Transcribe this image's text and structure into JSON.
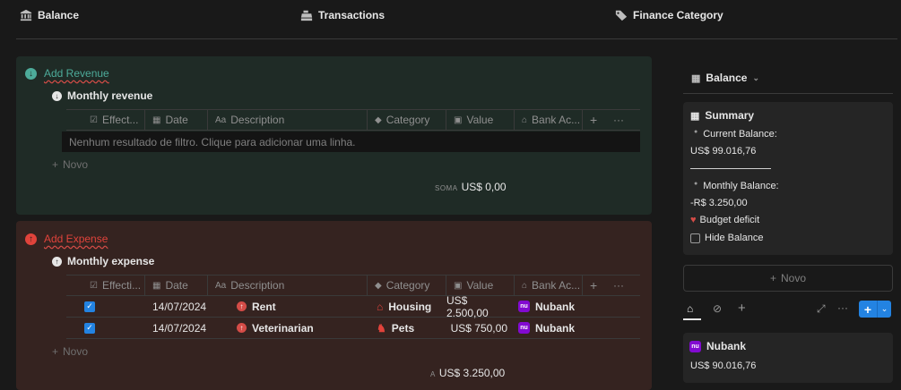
{
  "nav": {
    "balance": "Balance",
    "transactions": "Transactions",
    "finance_category": "Finance Category"
  },
  "revenue": {
    "title": "Add Revenue",
    "subtitle": "Monthly revenue",
    "columns": [
      "Effect...",
      "Date",
      "Description",
      "Category",
      "Value",
      "Bank Ac..."
    ],
    "empty_text": "Nenhum resultado de filtro. Clique para adicionar uma linha.",
    "new_label": "Novo",
    "sum_label": "SOMA",
    "sum_value": "US$ 0,00"
  },
  "expense": {
    "title": "Add Expense",
    "subtitle": "Monthly expense",
    "columns": [
      "Effecti...",
      "Date",
      "Description",
      "Category",
      "Value",
      "Bank Ac..."
    ],
    "rows": [
      {
        "checked": true,
        "date": "14/07/2024",
        "description": "Rent",
        "category": "Housing",
        "value": "US$ 2.500,00",
        "bank": "Nubank"
      },
      {
        "checked": true,
        "date": "14/07/2024",
        "description": "Veterinarian",
        "category": "Pets",
        "value": "US$ 750,00",
        "bank": "Nubank"
      }
    ],
    "new_label": "Novo",
    "sum_label": "A",
    "sum_value": "US$ 3.250,00"
  },
  "sidebar": {
    "view_label": "Balance",
    "summary": {
      "title": "Summary",
      "current_label": "Current Balance:",
      "current_value": "US$ 99.016,76",
      "monthly_label": "Monthly Balance:",
      "monthly_value": "-R$ 3.250,00",
      "deficit_label": "Budget deficit",
      "hide_label": "Hide Balance"
    },
    "new_label": "Novo",
    "bank_card": {
      "name": "Nubank",
      "balance": "US$ 90.016,76"
    }
  },
  "colors": {
    "revenue_accent": "#4dab9a",
    "expense_accent": "#e0433b",
    "revenue_bg": "#1f2b26",
    "expense_bg": "#352320",
    "checkbox_blue": "#2383e2",
    "nubank_purple": "#820ad1"
  }
}
